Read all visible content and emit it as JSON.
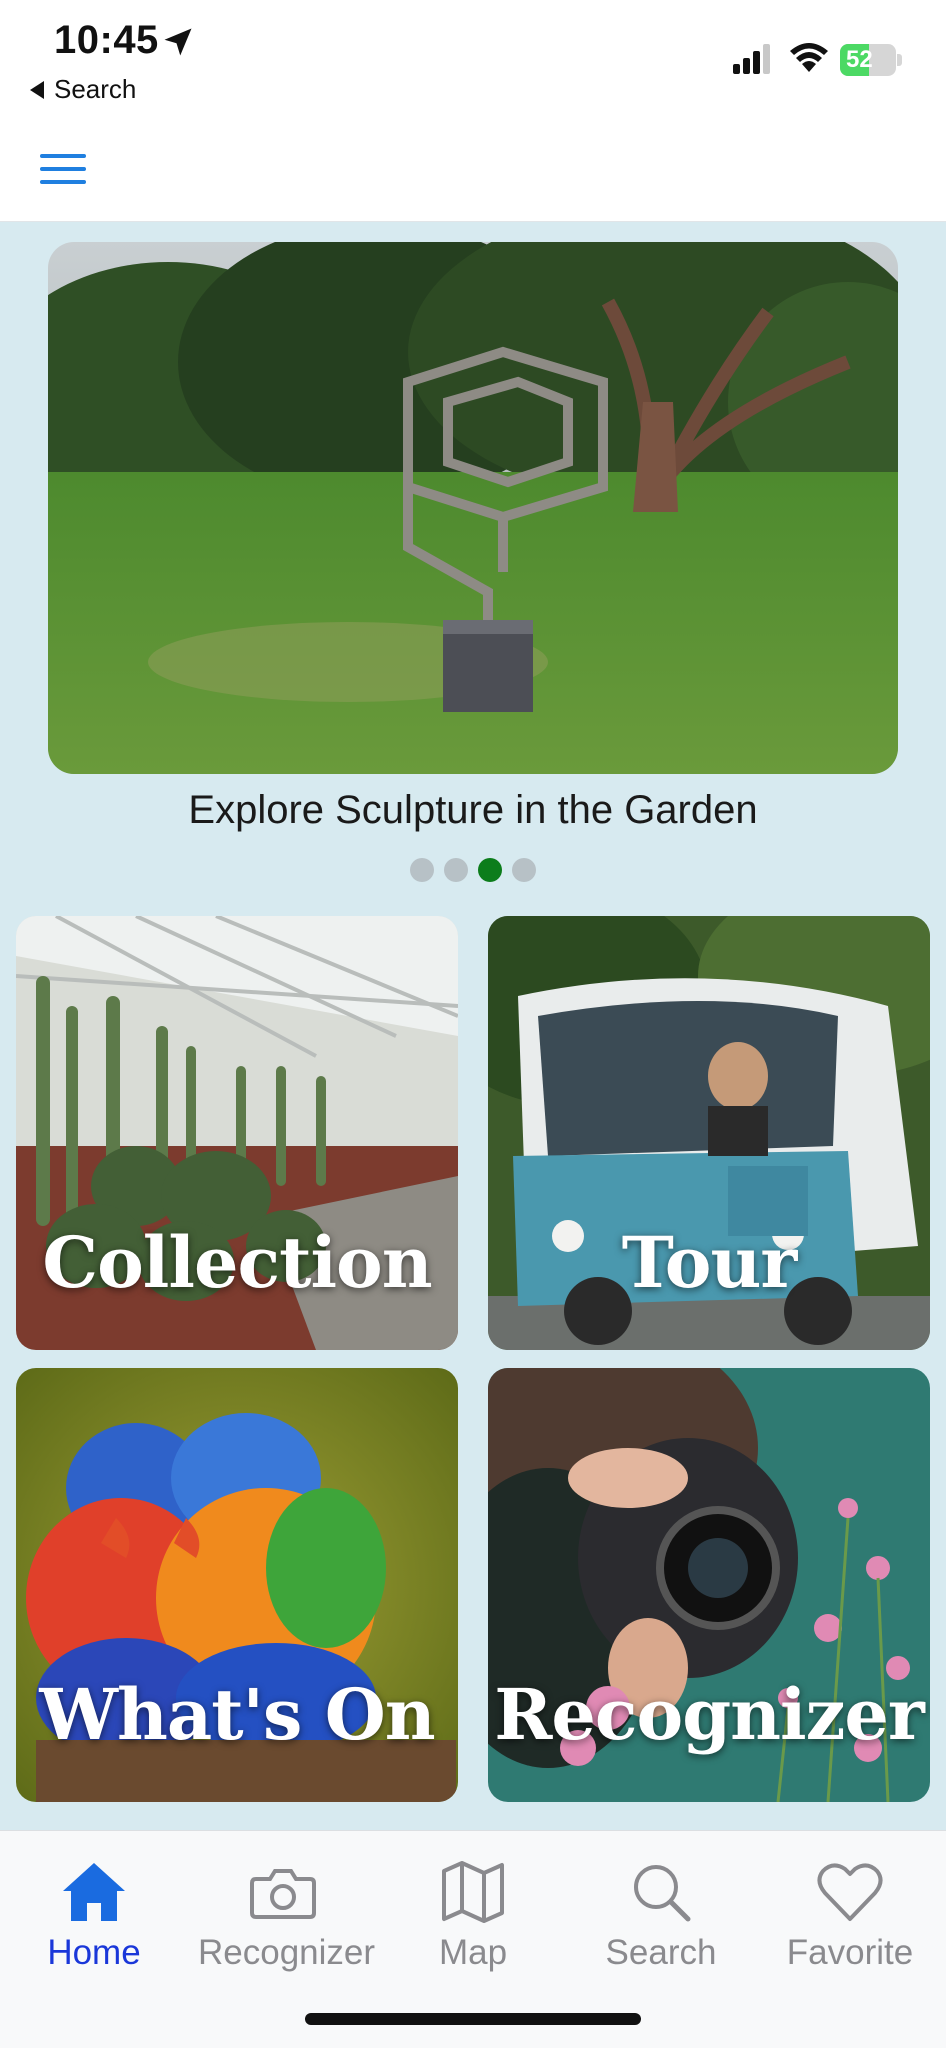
{
  "status_bar": {
    "time": "10:45",
    "back_label": "Search",
    "battery_level": 52,
    "battery_text": "52"
  },
  "app_bar": {
    "menu_icon": "hamburger-menu-icon"
  },
  "carousel": {
    "caption": "Explore Sculpture in the Garden",
    "page_count": 4,
    "active_index": 2,
    "active_color": "#0c7d1b",
    "inactive_color": "#b7c1c6"
  },
  "tiles": [
    {
      "label": "Collection"
    },
    {
      "label": "Tour"
    },
    {
      "label": "What's On"
    },
    {
      "label": "Recognizer"
    }
  ],
  "tab_bar": {
    "active_color": "#1a37d9",
    "inactive_color": "#8a8a8e",
    "tabs": [
      {
        "label": "Home",
        "icon": "house-icon",
        "active": true
      },
      {
        "label": "Recognizer",
        "icon": "camera-icon",
        "active": false
      },
      {
        "label": "Map",
        "icon": "map-icon",
        "active": false
      },
      {
        "label": "Search",
        "icon": "magnifier-icon",
        "active": false
      },
      {
        "label": "Favorite",
        "icon": "heart-icon",
        "active": false
      }
    ]
  },
  "colors": {
    "content_background": "#d7eaf0",
    "menu_icon": "#1f7fe0"
  }
}
